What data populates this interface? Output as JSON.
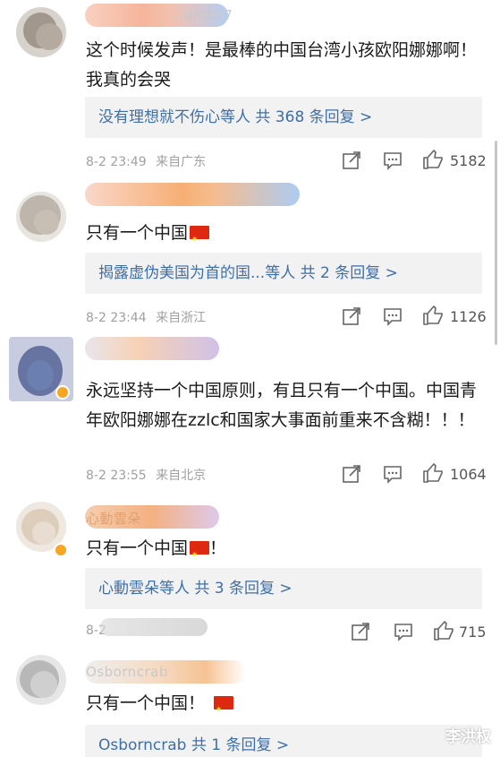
{
  "comments": [
    {
      "username": "…dinb77",
      "text": "这个时候发声！是最棒的中国台湾小孩欧阳娜娜啊！我真的会哭",
      "reply_summary": "没有理想就不伤心等人  共 368 条回复 >",
      "date": "8-2 23:49",
      "location": "来自广东",
      "likes": "5182",
      "has_flag": false
    },
    {
      "username": "",
      "text": "只有一个中国",
      "reply_summary": "揭露虚伪美国为首的国...等人  共 2 条回复 >",
      "date": "8-2 23:44",
      "location": "来自浙江",
      "likes": "1126",
      "has_flag": true
    },
    {
      "username": "",
      "text": "永远坚持一个中国原则，有且只有一个中国。中国青年欧阳娜娜在zzlc和国家大事面前重来不含糊！！！",
      "reply_summary": "",
      "date": "8-2 23:55",
      "location": "来自北京",
      "likes": "1064",
      "has_flag": false
    },
    {
      "username": "心動雲朵",
      "text": "只有一个中国！",
      "reply_summary": "心動雲朵等人  共 3 条回复 >",
      "date": "8-2",
      "location": "",
      "likes": "715",
      "has_flag": true
    },
    {
      "username": "Osborncrab",
      "text": "只有一个中国！",
      "reply_summary": "Osborncrab  共 1 条回复 >",
      "date": "",
      "location": "",
      "likes": "",
      "has_flag": true
    }
  ],
  "icons": {
    "share": "share-icon",
    "comment": "comment-icon",
    "like": "thumbs-up-icon",
    "verified": "verified-badge-icon"
  },
  "colors": {
    "link": "#3f6fa8",
    "reply_bg": "#f2f2f2",
    "meta": "#a0a0a0",
    "flag_red": "#de2910"
  },
  "watermark": "李洪权"
}
